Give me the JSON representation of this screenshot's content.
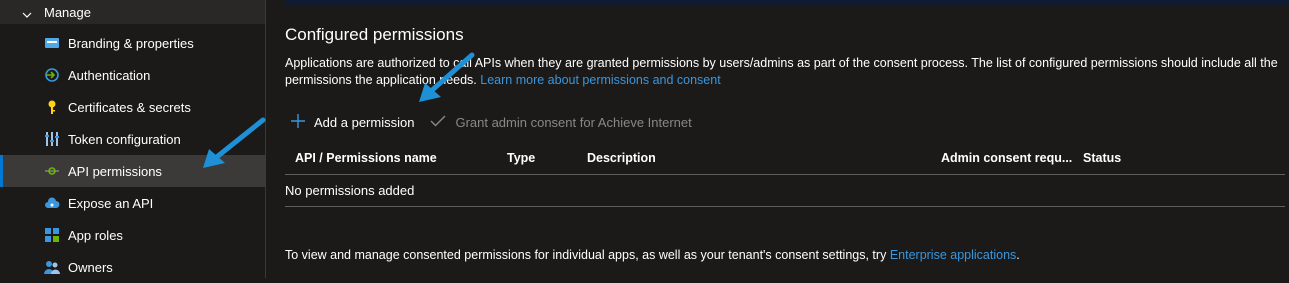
{
  "sidebar": {
    "section_label": "Manage",
    "items": [
      {
        "label": "Branding & properties",
        "icon": "branding-icon"
      },
      {
        "label": "Authentication",
        "icon": "authentication-icon"
      },
      {
        "label": "Certificates & secrets",
        "icon": "key-icon"
      },
      {
        "label": "Token configuration",
        "icon": "token-config-icon"
      },
      {
        "label": "API permissions",
        "icon": "api-permissions-icon",
        "selected": true
      },
      {
        "label": "Expose an API",
        "icon": "cloud-icon"
      },
      {
        "label": "App roles",
        "icon": "app-roles-icon"
      },
      {
        "label": "Owners",
        "icon": "owners-icon"
      }
    ]
  },
  "main": {
    "title": "Configured permissions",
    "description_text": "Applications are authorized to call APIs when they are granted permissions by users/admins as part of the consent process. The list of configured permissions should include all the permissions the application needs.",
    "description_link": "Learn more about permissions and consent",
    "toolbar": {
      "add_permission_label": "Add a permission",
      "grant_consent_label": "Grant admin consent for Achieve Internet"
    },
    "table": {
      "columns": [
        "API / Permissions name",
        "Type",
        "Description",
        "Admin consent requ...",
        "Status"
      ],
      "empty_message": "No permissions added"
    },
    "footer_text": "To view and manage consented permissions for individual apps, as well as your tenant's consent settings, try",
    "footer_link": "Enterprise applications",
    "footer_period": "."
  },
  "colors": {
    "background": "#1b1a19",
    "selected_item": "#3b3a39",
    "accent": "#0078d4",
    "link": "#3a96dd",
    "annotation_arrow": "#1e90d6",
    "disabled_text": "#8a8886"
  }
}
